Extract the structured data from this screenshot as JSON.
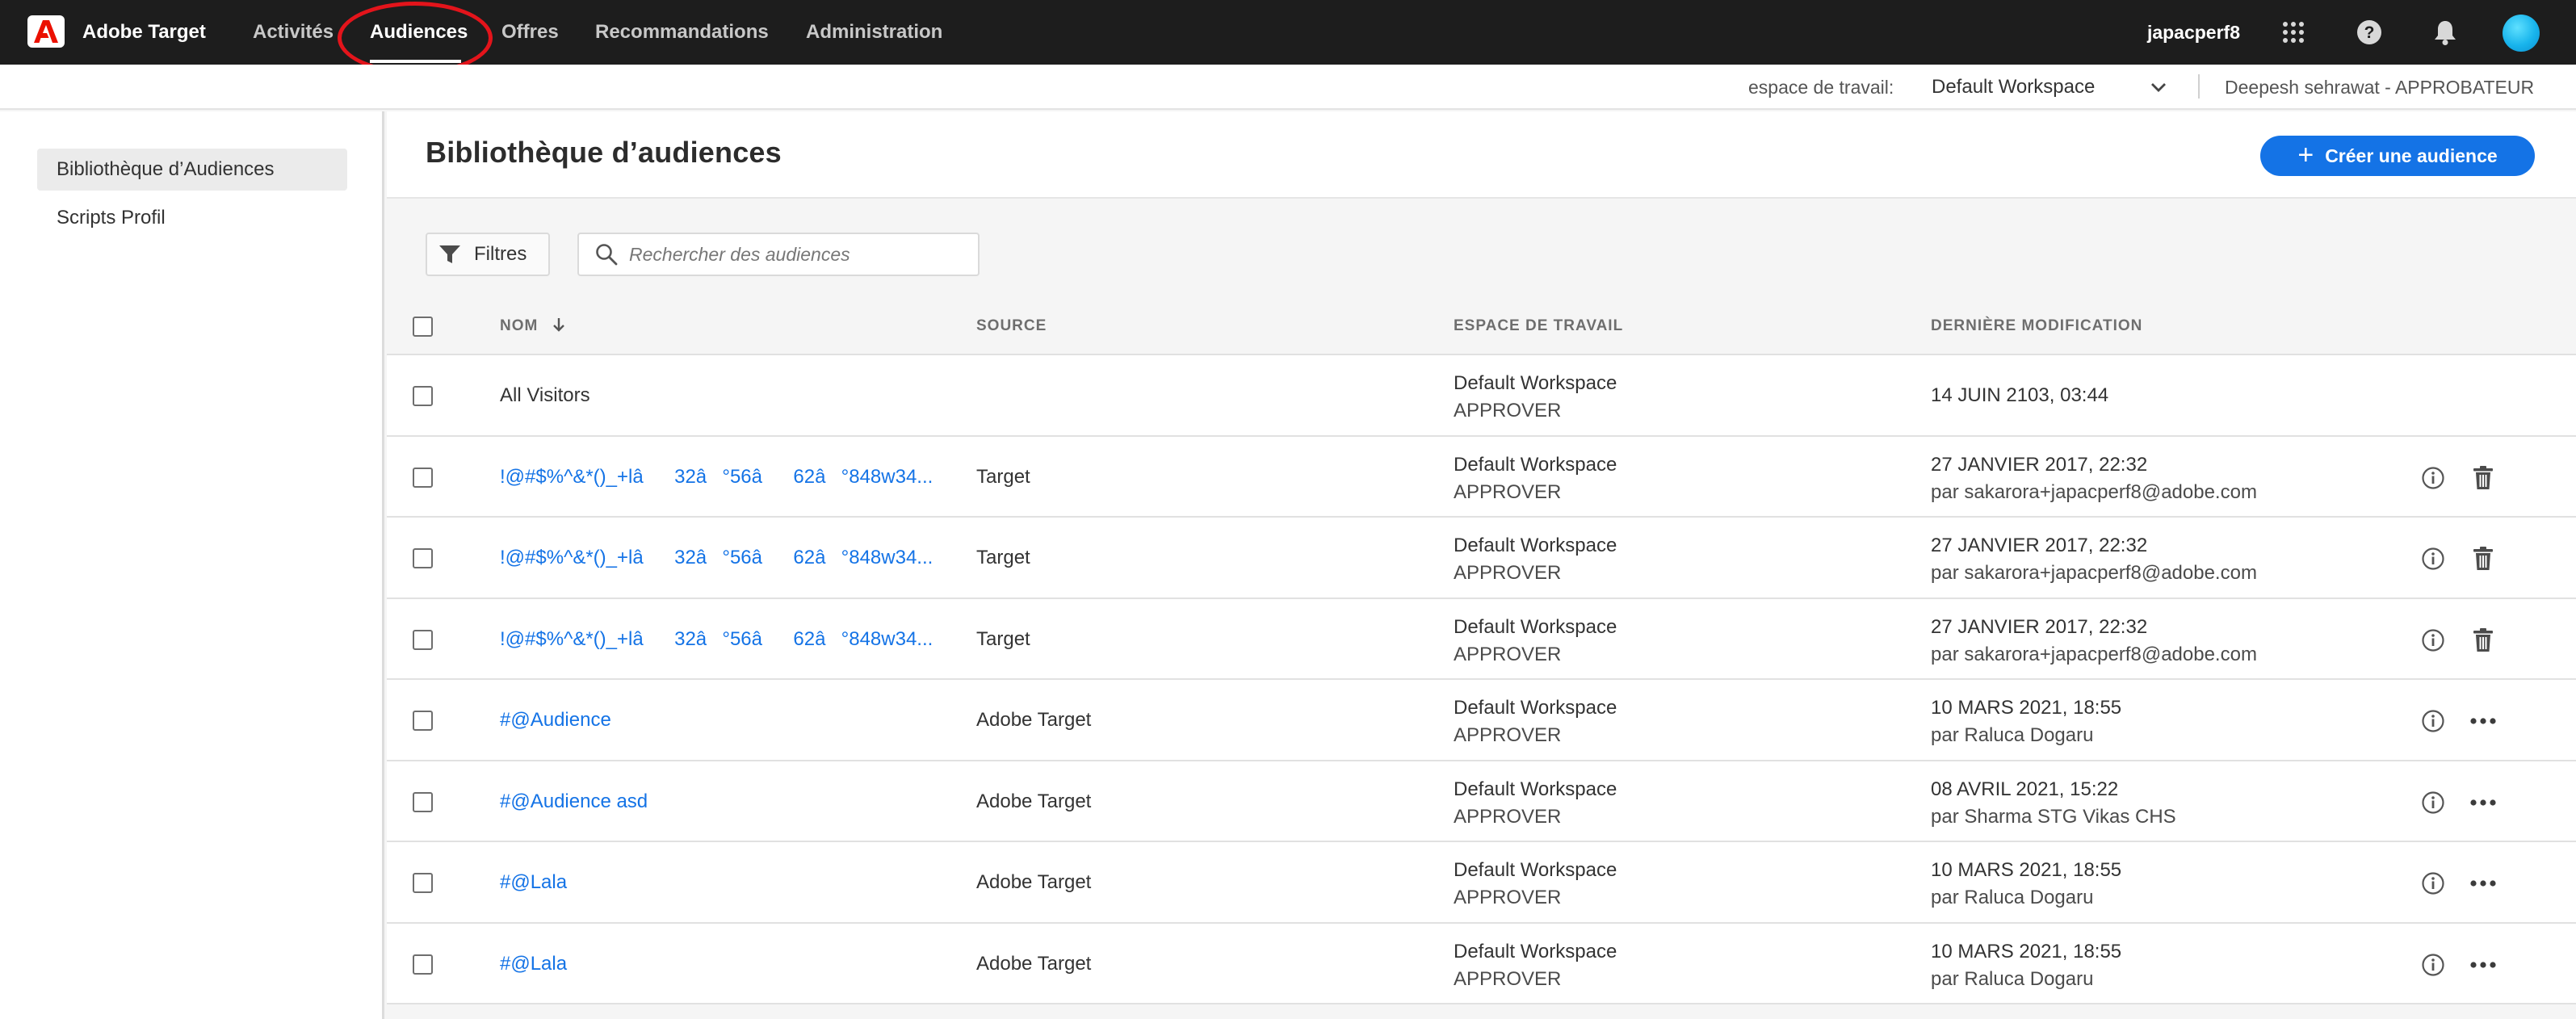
{
  "topbar": {
    "app_title": "Adobe Target",
    "nav": [
      "Activités",
      "Audiences",
      "Offres",
      "Recommandations",
      "Administration"
    ],
    "active_nav": "Audiences",
    "user": "japacperf8",
    "icons": [
      "apps-grid-icon",
      "help-icon",
      "bell-icon",
      "avatar"
    ]
  },
  "workspace_bar": {
    "label": "espace de travail:",
    "workspace": "Default Workspace",
    "user_role": "Deepesh sehrawat - APPROBATEUR"
  },
  "sidebar": {
    "items": [
      {
        "label": "Bibliothèque d’Audiences",
        "selected": true
      },
      {
        "label": "Scripts Profil",
        "selected": false
      }
    ]
  },
  "main": {
    "title": "Bibliothèque d’audiences",
    "create_button": "Créer une audience",
    "filters_button": "Filtres",
    "search_placeholder": "Rechercher des audiences"
  },
  "table": {
    "columns": {
      "name": "NOM",
      "source": "SOURCE",
      "workspace": "ESPACE DE TRAVAIL",
      "modified": "DERNIÈRE MODIFICATION"
    },
    "sort": {
      "column": "name",
      "direction": "descending-arrow"
    },
    "rows": [
      {
        "name": "All Visitors",
        "source": "",
        "workspace": "Default Workspace",
        "role": "APPROVER",
        "modified": "14 JUIN 2103, 03:44",
        "by": "",
        "actions": []
      },
      {
        "name": "!@#$%^&*()_+lâ32â°56â62â°848w34...",
        "source": "Target",
        "workspace": "Default Workspace",
        "role": "APPROVER",
        "modified": "27 JANVIER 2017, 22:32",
        "by": "par sakarora+japacperf8@adobe.com",
        "actions": [
          "info",
          "delete"
        ]
      },
      {
        "name": "!@#$%^&*()_+lâ32â°56â62â°848w34...",
        "source": "Target",
        "workspace": "Default Workspace",
        "role": "APPROVER",
        "modified": "27 JANVIER 2017, 22:32",
        "by": "par sakarora+japacperf8@adobe.com",
        "actions": [
          "info",
          "delete"
        ]
      },
      {
        "name": "!@#$%^&*()_+lâ32â°56â62â°848w34...",
        "source": "Target",
        "workspace": "Default Workspace",
        "role": "APPROVER",
        "modified": "27 JANVIER 2017, 22:32",
        "by": "par sakarora+japacperf8@adobe.com",
        "actions": [
          "info",
          "delete"
        ]
      },
      {
        "name": "#@Audience",
        "source": "Adobe Target",
        "workspace": "Default Workspace",
        "role": "APPROVER",
        "modified": "10 MARS 2021, 18:55",
        "by": "par Raluca Dogaru",
        "actions": [
          "info",
          "more"
        ]
      },
      {
        "name": "#@Audience asd",
        "source": "Adobe Target",
        "workspace": "Default Workspace",
        "role": "APPROVER",
        "modified": "08 AVRIL 2021, 15:22",
        "by": "par Sharma STG Vikas CHS",
        "actions": [
          "info",
          "more"
        ]
      },
      {
        "name": "#@Lala",
        "source": "Adobe Target",
        "workspace": "Default Workspace",
        "role": "APPROVER",
        "modified": "10 MARS 2021, 18:55",
        "by": "par Raluca Dogaru",
        "actions": [
          "info",
          "more"
        ]
      },
      {
        "name": "#@Lala",
        "source": "Adobe Target",
        "workspace": "Default Workspace",
        "role": "APPROVER",
        "modified": "10 MARS 2021, 18:55",
        "by": "par Raluca Dogaru",
        "actions": [
          "info",
          "more"
        ]
      }
    ]
  },
  "colors": {
    "topbar": "#1d1d1d",
    "accent": "#1473e6",
    "highlight_ring": "#e3141b",
    "adobe_red": "#eb1000"
  }
}
